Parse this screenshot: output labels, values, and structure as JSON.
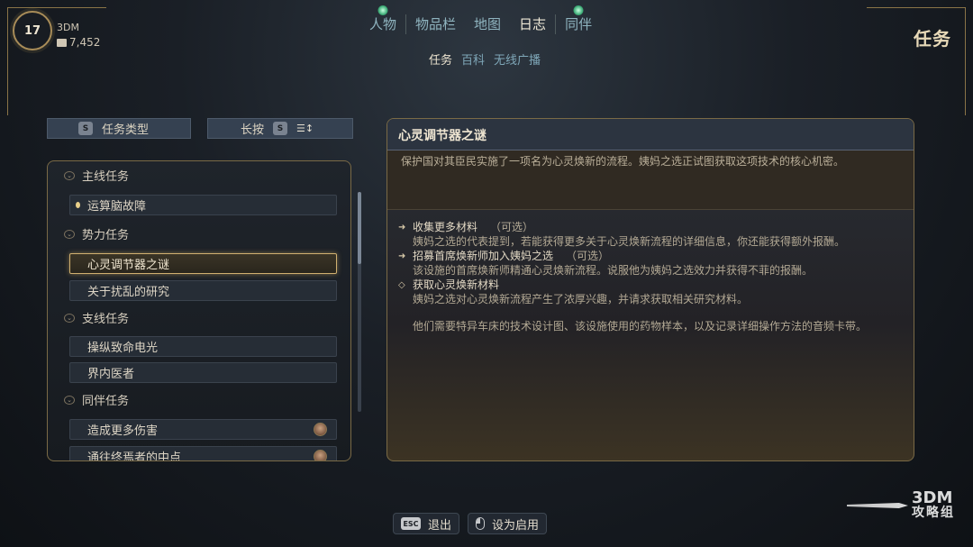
{
  "player": {
    "level": "17",
    "name": "3DM",
    "gold": "7,452"
  },
  "topnav": {
    "tabs": [
      "人物",
      "物品栏",
      "地图",
      "日志",
      "同伴"
    ],
    "active": "日志"
  },
  "subnav": {
    "tabs": [
      "任务",
      "百科",
      "无线广播"
    ],
    "active": "任务"
  },
  "page_title": "任务",
  "filter": {
    "type_label": "任务类型",
    "type_key": "S",
    "longpress_label": "长按",
    "longpress_key": "S"
  },
  "quest_list": {
    "main_category": "主线任务",
    "main_items": [
      "运算脑故障"
    ],
    "faction_category": "势力任务",
    "faction_items": [
      "心灵调节器之谜",
      "关于扰乱的研究"
    ],
    "side_category": "支线任务",
    "side_items": [
      "操纵致命电光",
      "界内医者"
    ],
    "companion_category": "同伴任务",
    "companion_items": [
      "造成更多伤害",
      "通往终焉者的中点"
    ]
  },
  "detail": {
    "title": "心灵调节器之谜",
    "description": "保护国对其臣民实施了一项名为心灵焕新的流程。姨妈之选正试图获取这项技术的核心机密。",
    "objectives": [
      {
        "title": "收集更多材料",
        "optional": "（可选）",
        "body": "姨妈之选的代表提到，若能获得更多关于心灵焕新流程的详细信息，你还能获得额外报酬。"
      },
      {
        "title": "招募首席焕新师加入姨妈之选",
        "optional": "（可选）",
        "body": "该设施的首席焕新师精通心灵焕新流程。说服他为姨妈之选效力并获得不菲的报酬。"
      },
      {
        "title": "获取心灵焕新材料",
        "optional": "",
        "body": "姨妈之选对心灵焕新流程产生了浓厚兴趣，并请求获取相关研究材料。"
      }
    ],
    "extra": "他们需要特异车床的技术设计图、该设施使用的药物样本，以及记录详细操作方法的音频卡带。"
  },
  "actions": {
    "exit_key": "ESC",
    "exit_label": "退出",
    "enable_label": "设为启用"
  },
  "watermark": {
    "line1": "3DM",
    "line2": "攻略组"
  }
}
